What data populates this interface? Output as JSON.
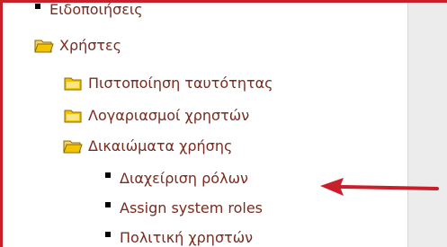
{
  "tree": {
    "item_notifications": "Ειδοποιήσεις",
    "item_users": "Χρήστες",
    "item_authentication": "Πιστοποίηση ταυτότητας",
    "item_accounts": "Λογαριασμοί χρηστών",
    "item_permissions": "Δικαιώματα χρήσης",
    "item_define_roles": "Διαχείριση ρόλων",
    "item_assign_roles": "Assign system roles",
    "item_user_policies": "Πολιτική χρηστών"
  },
  "colors": {
    "border": "#c8202a",
    "link_text": "#7a2b1e",
    "arrow": "#c8202a",
    "folder_yellow": "#f2c300"
  },
  "icons": {
    "folder_open": "folder-open-icon",
    "folder_closed": "folder-icon",
    "bullet": "bullet-icon",
    "arrow": "arrow-pointer"
  }
}
